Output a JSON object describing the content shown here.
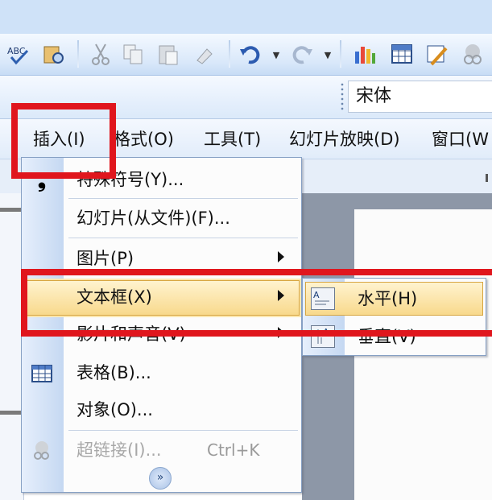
{
  "toolbar": {
    "icons": [
      "spelling-icon",
      "research-icon",
      "cut-icon",
      "copy-icon",
      "paste-icon",
      "format-painter-icon",
      "undo-icon",
      "redo-icon",
      "chart-icon",
      "table-icon",
      "tables-borders-icon",
      "hyperlink-icon"
    ]
  },
  "format_bar": {
    "font_name": "宋体"
  },
  "menubar": {
    "items": [
      "插入(I)",
      "格式(O)",
      "工具(T)",
      "幻灯片放映(D)",
      "窗口(W"
    ]
  },
  "insert_menu": {
    "items": [
      {
        "label": "特殊符号(Y)...",
        "icon": "special-symbol-icon",
        "submenu": false
      },
      {
        "label": "幻灯片(从文件)(F)...",
        "icon": "",
        "submenu": false
      },
      {
        "label": "图片(P)",
        "icon": "",
        "submenu": true
      },
      {
        "label": "文本框(X)",
        "icon": "",
        "submenu": true,
        "highlighted": true
      },
      {
        "label": "影片和声音(V)",
        "icon": "",
        "submenu": true
      },
      {
        "label": "表格(B)...",
        "icon": "table-icon",
        "submenu": false
      },
      {
        "label": "对象(O)...",
        "icon": "",
        "submenu": false
      },
      {
        "label": "超链接(I)...",
        "icon": "hyperlink-icon",
        "submenu": false,
        "disabled": true,
        "shortcut": "Ctrl+K"
      }
    ]
  },
  "textbox_submenu": {
    "items": [
      {
        "label": "水平(H)",
        "icon": "horizontal-textbox-icon",
        "highlighted": true
      },
      {
        "label": "垂直(V)",
        "icon": "vertical-textbox-icon"
      }
    ]
  },
  "colors": {
    "highlight_red": "#e0161d",
    "hover_fill": "#f8d98c",
    "gutter": "#c5d8f2"
  }
}
